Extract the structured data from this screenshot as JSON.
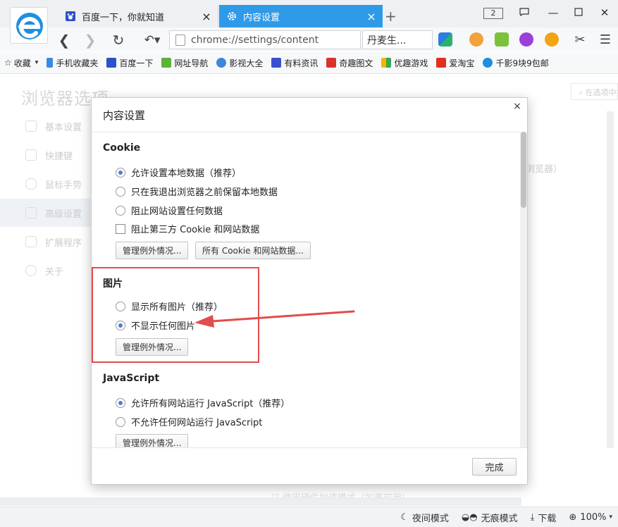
{
  "tabs": [
    {
      "title": "百度一下，你就知道",
      "icon": "baidu-paw-icon",
      "active": false
    },
    {
      "title": "内容设置",
      "icon": "settings-gear-icon",
      "active": true
    }
  ],
  "tab_count": "2",
  "address": {
    "url": "chrome://settings/content",
    "dropdown": "丹麦生..."
  },
  "bookmarks": [
    {
      "label": "收藏",
      "icon": "star-icon"
    },
    {
      "label": "手机收藏夹",
      "icon": "phone-icon"
    },
    {
      "label": "百度一下",
      "icon": "baidu-paw-icon"
    },
    {
      "label": "网址导航",
      "icon": "hao-check-icon"
    },
    {
      "label": "影视大全",
      "icon": "video-icon"
    },
    {
      "label": "有料资讯",
      "icon": "news-icon"
    },
    {
      "label": "奇趣图文",
      "icon": "qiqu-icon"
    },
    {
      "label": "优趣游戏",
      "icon": "game-icon"
    },
    {
      "label": "爱淘宝",
      "icon": "taobao-icon"
    },
    {
      "label": "千影9块9包邮",
      "icon": "ie-icon"
    }
  ],
  "settings_page": {
    "title": "浏览器选项",
    "search_placeholder": "在选项中搜索",
    "sidebar": [
      {
        "label": "基本设置",
        "icon": "gear-icon"
      },
      {
        "label": "快捷键",
        "icon": "keyboard-icon"
      },
      {
        "label": "鼠标手势",
        "icon": "mouse-icon"
      },
      {
        "label": "高级设置",
        "icon": "advanced-icon",
        "active": true
      },
      {
        "label": "扩展程序",
        "icon": "puzzle-icon"
      },
      {
        "label": "关于",
        "icon": "info-icon"
      }
    ],
    "bg_text": "浏览器）",
    "bg_bottom_text": "使用硬件加速模式（如果可用）"
  },
  "dialog": {
    "title": "内容设置",
    "close": "×",
    "cookie": {
      "heading": "Cookie",
      "options": [
        {
          "label": "允许设置本地数据（推荐）",
          "checked": true
        },
        {
          "label": "只在我退出浏览器之前保留本地数据",
          "checked": false
        },
        {
          "label": "阻止网站设置任何数据",
          "checked": false
        }
      ],
      "checkbox": "阻止第三方 Cookie 和网站数据",
      "btn_exceptions": "管理例外情况...",
      "btn_all": "所有 Cookie 和网站数据..."
    },
    "images": {
      "heading": "图片",
      "options": [
        {
          "label": "显示所有图片（推荐）",
          "checked": false
        },
        {
          "label": "不显示任何图片",
          "checked": true
        }
      ],
      "btn_exceptions": "管理例外情况..."
    },
    "javascript": {
      "heading": "JavaScript",
      "options": [
        {
          "label": "允许所有网站运行 JavaScript（推荐）",
          "checked": true
        },
        {
          "label": "不允许任何网站运行 JavaScript",
          "checked": false
        }
      ],
      "btn_exceptions": "管理例外情况..."
    },
    "done": "完成"
  },
  "statusbar": {
    "night": "夜间模式",
    "incognito": "无痕模式",
    "download": "下载",
    "zoom": "100%"
  },
  "colors": {
    "accent": "#2e9ae8",
    "highlight": "#e24c4c"
  }
}
